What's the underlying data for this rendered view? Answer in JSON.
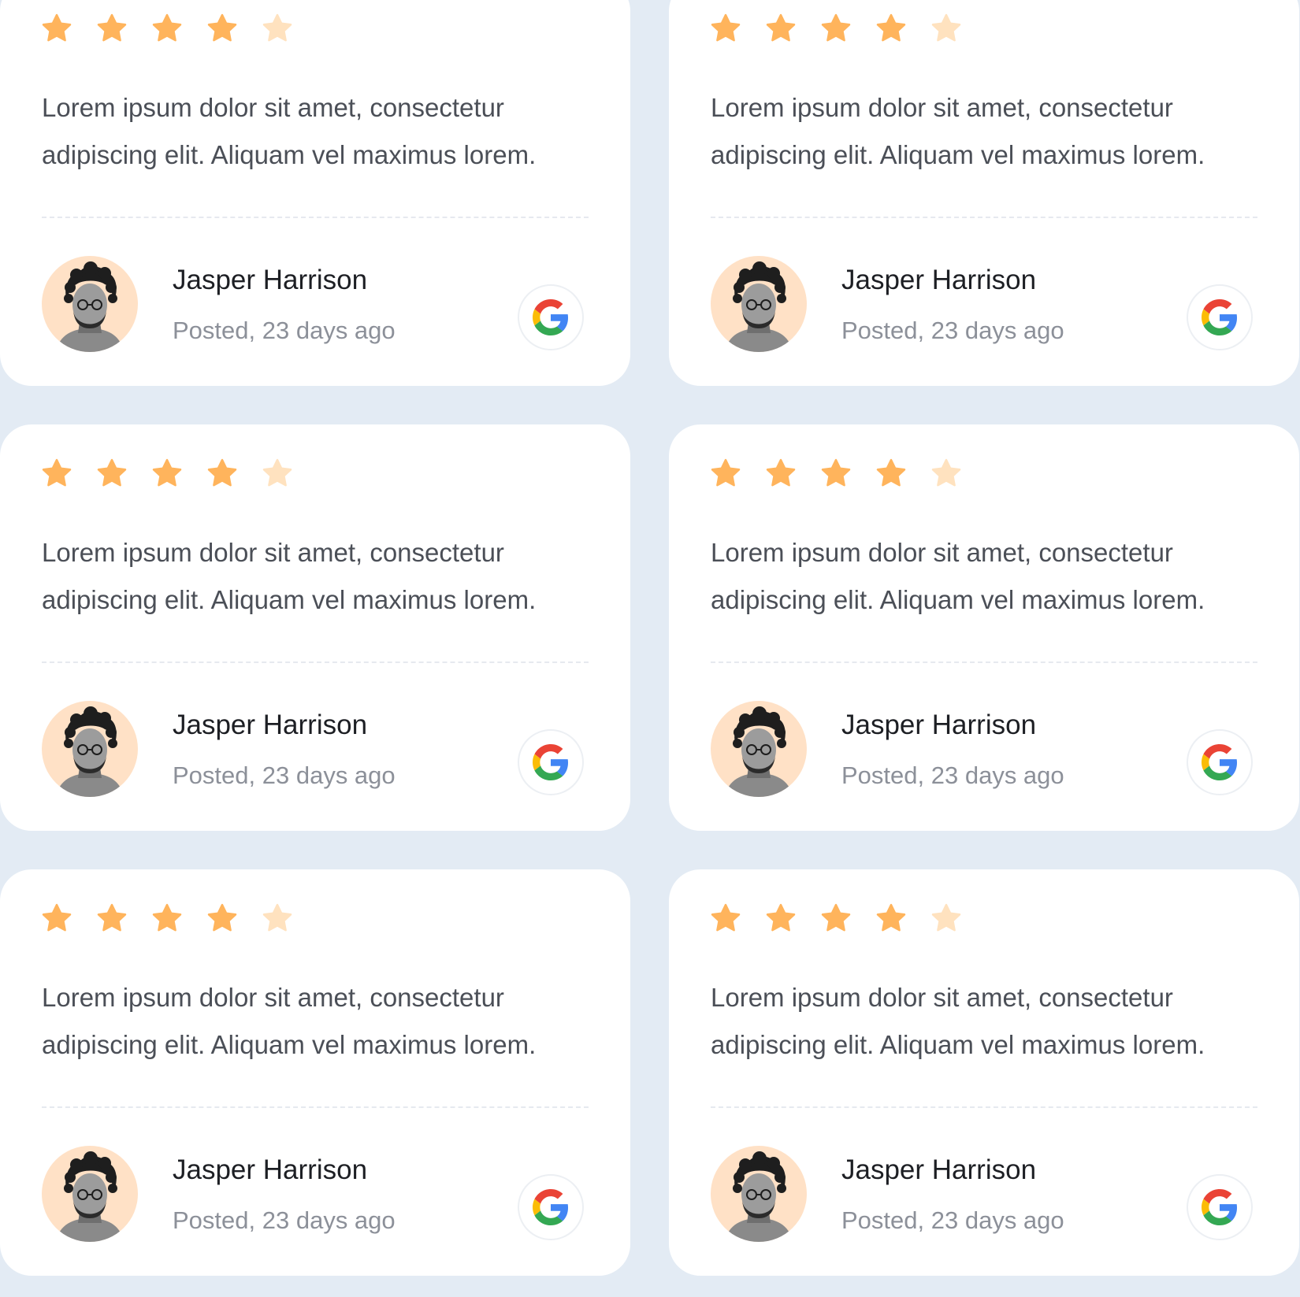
{
  "colors": {
    "star_filled": "#FFB45C",
    "star_empty": "#FFE2BF",
    "avatar_bg": "#FFE1C6",
    "page_bg": "#E3EBF4"
  },
  "reviews": [
    {
      "rating": 4,
      "max_rating": 5,
      "text": "Lorem ipsum dolor sit amet, consectetur adipiscing elit. Aliquam vel maximus lorem.",
      "author": "Jasper Harrison",
      "posted": "Posted, 23 days ago",
      "source_icon": "google-icon"
    },
    {
      "rating": 4,
      "max_rating": 5,
      "text": "Lorem ipsum dolor sit amet, consectetur adipiscing elit. Aliquam vel maximus lorem.",
      "author": "Jasper Harrison",
      "posted": "Posted, 23 days ago",
      "source_icon": "google-icon"
    },
    {
      "rating": 4,
      "max_rating": 5,
      "text": "Lorem ipsum dolor sit amet, consectetur adipiscing elit. Aliquam vel maximus lorem.",
      "author": "Jasper Harrison",
      "posted": "Posted, 23 days ago",
      "source_icon": "google-icon"
    },
    {
      "rating": 4,
      "max_rating": 5,
      "text": "Lorem ipsum dolor sit amet, consectetur adipiscing elit. Aliquam vel maximus lorem.",
      "author": "Jasper Harrison",
      "posted": "Posted, 23 days ago",
      "source_icon": "google-icon"
    },
    {
      "rating": 4,
      "max_rating": 5,
      "text": "Lorem ipsum dolor sit amet, consectetur adipiscing elit. Aliquam vel maximus lorem.",
      "author": "Jasper Harrison",
      "posted": "Posted, 23 days ago",
      "source_icon": "google-icon"
    },
    {
      "rating": 4,
      "max_rating": 5,
      "text": "Lorem ipsum dolor sit amet, consectetur adipiscing elit. Aliquam vel maximus lorem.",
      "author": "Jasper Harrison",
      "posted": "Posted, 23 days ago",
      "source_icon": "google-icon"
    }
  ]
}
